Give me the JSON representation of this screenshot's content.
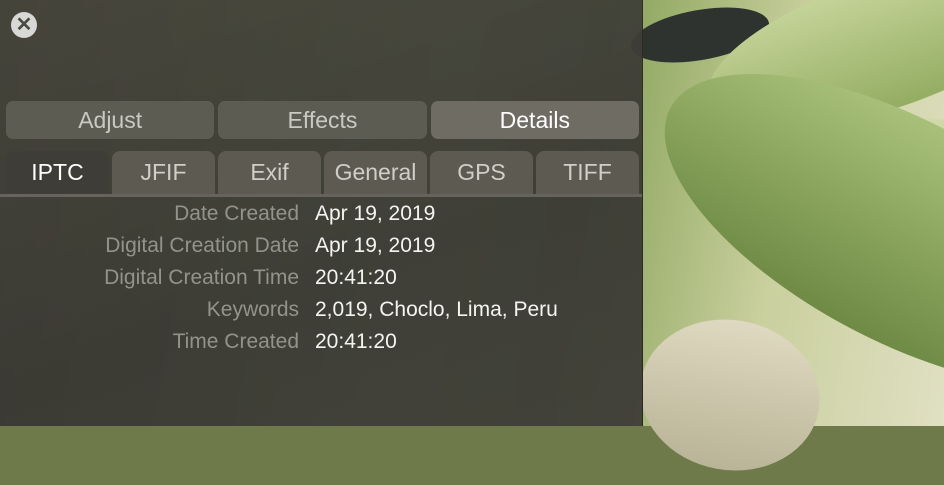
{
  "window": {
    "close_symbol": "✕",
    "close_icon": "close-circle-icon"
  },
  "segmented_tabs": [
    {
      "label": "Adjust",
      "active": false
    },
    {
      "label": "Effects",
      "active": false
    },
    {
      "label": "Details",
      "active": true
    }
  ],
  "sub_tabs": [
    {
      "label": "IPTC",
      "active": true
    },
    {
      "label": "JFIF",
      "active": false
    },
    {
      "label": "Exif",
      "active": false
    },
    {
      "label": "General",
      "active": false
    },
    {
      "label": "GPS",
      "active": false
    },
    {
      "label": "TIFF",
      "active": false
    }
  ],
  "metadata": [
    {
      "key": "Date Created",
      "value": "Apr 19, 2019"
    },
    {
      "key": "Digital Creation Date",
      "value": "Apr 19, 2019"
    },
    {
      "key": "Digital Creation Time",
      "value": "20:41:20"
    },
    {
      "key": "Keywords",
      "value": "2,019, Choclo, Lima, Peru"
    },
    {
      "key": "Time Created",
      "value": "20:41:20"
    }
  ],
  "colors": {
    "panel_bg": "#3f3e38",
    "active_text": "#ffffff",
    "label_text": "#93928b"
  }
}
